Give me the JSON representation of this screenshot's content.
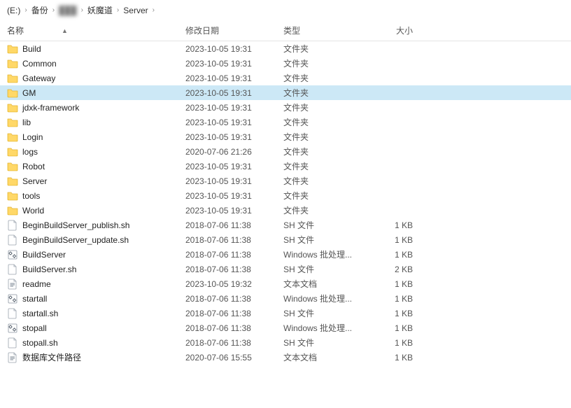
{
  "breadcrumb": {
    "segments": [
      "(E:)",
      "备份",
      "███",
      "妖魔道",
      "Server"
    ],
    "blurred_index": 2
  },
  "columns": {
    "name": "名称",
    "date": "修改日期",
    "type": "类型",
    "size": "大小",
    "sort_indicator": "▲"
  },
  "rows": [
    {
      "icon": "folder",
      "name": "Build",
      "date": "2023-10-05 19:31",
      "type": "文件夹",
      "size": "",
      "selected": false
    },
    {
      "icon": "folder",
      "name": "Common",
      "date": "2023-10-05 19:31",
      "type": "文件夹",
      "size": "",
      "selected": false
    },
    {
      "icon": "folder",
      "name": "Gateway",
      "date": "2023-10-05 19:31",
      "type": "文件夹",
      "size": "",
      "selected": false
    },
    {
      "icon": "folder",
      "name": "GM",
      "date": "2023-10-05 19:31",
      "type": "文件夹",
      "size": "",
      "selected": true
    },
    {
      "icon": "folder",
      "name": "jdxk-framework",
      "date": "2023-10-05 19:31",
      "type": "文件夹",
      "size": "",
      "selected": false
    },
    {
      "icon": "folder",
      "name": "lib",
      "date": "2023-10-05 19:31",
      "type": "文件夹",
      "size": "",
      "selected": false
    },
    {
      "icon": "folder",
      "name": "Login",
      "date": "2023-10-05 19:31",
      "type": "文件夹",
      "size": "",
      "selected": false
    },
    {
      "icon": "folder",
      "name": "logs",
      "date": "2020-07-06 21:26",
      "type": "文件夹",
      "size": "",
      "selected": false
    },
    {
      "icon": "folder",
      "name": "Robot",
      "date": "2023-10-05 19:31",
      "type": "文件夹",
      "size": "",
      "selected": false
    },
    {
      "icon": "folder",
      "name": "Server",
      "date": "2023-10-05 19:31",
      "type": "文件夹",
      "size": "",
      "selected": false
    },
    {
      "icon": "folder",
      "name": "tools",
      "date": "2023-10-05 19:31",
      "type": "文件夹",
      "size": "",
      "selected": false
    },
    {
      "icon": "folder",
      "name": "World",
      "date": "2023-10-05 19:31",
      "type": "文件夹",
      "size": "",
      "selected": false
    },
    {
      "icon": "file",
      "name": "BeginBuildServer_publish.sh",
      "date": "2018-07-06 11:38",
      "type": "SH 文件",
      "size": "1 KB",
      "selected": false
    },
    {
      "icon": "file",
      "name": "BeginBuildServer_update.sh",
      "date": "2018-07-06 11:38",
      "type": "SH 文件",
      "size": "1 KB",
      "selected": false
    },
    {
      "icon": "batch",
      "name": "BuildServer",
      "date": "2018-07-06 11:38",
      "type": "Windows 批处理...",
      "size": "1 KB",
      "selected": false
    },
    {
      "icon": "file",
      "name": "BuildServer.sh",
      "date": "2018-07-06 11:38",
      "type": "SH 文件",
      "size": "2 KB",
      "selected": false
    },
    {
      "icon": "text",
      "name": "readme",
      "date": "2023-10-05 19:32",
      "type": "文本文档",
      "size": "1 KB",
      "selected": false
    },
    {
      "icon": "batch",
      "name": "startall",
      "date": "2018-07-06 11:38",
      "type": "Windows 批处理...",
      "size": "1 KB",
      "selected": false
    },
    {
      "icon": "file",
      "name": "startall.sh",
      "date": "2018-07-06 11:38",
      "type": "SH 文件",
      "size": "1 KB",
      "selected": false
    },
    {
      "icon": "batch",
      "name": "stopall",
      "date": "2018-07-06 11:38",
      "type": "Windows 批处理...",
      "size": "1 KB",
      "selected": false
    },
    {
      "icon": "file",
      "name": "stopall.sh",
      "date": "2018-07-06 11:38",
      "type": "SH 文件",
      "size": "1 KB",
      "selected": false
    },
    {
      "icon": "text",
      "name": "数据库文件路径",
      "date": "2020-07-06 15:55",
      "type": "文本文档",
      "size": "1 KB",
      "selected": false
    }
  ]
}
